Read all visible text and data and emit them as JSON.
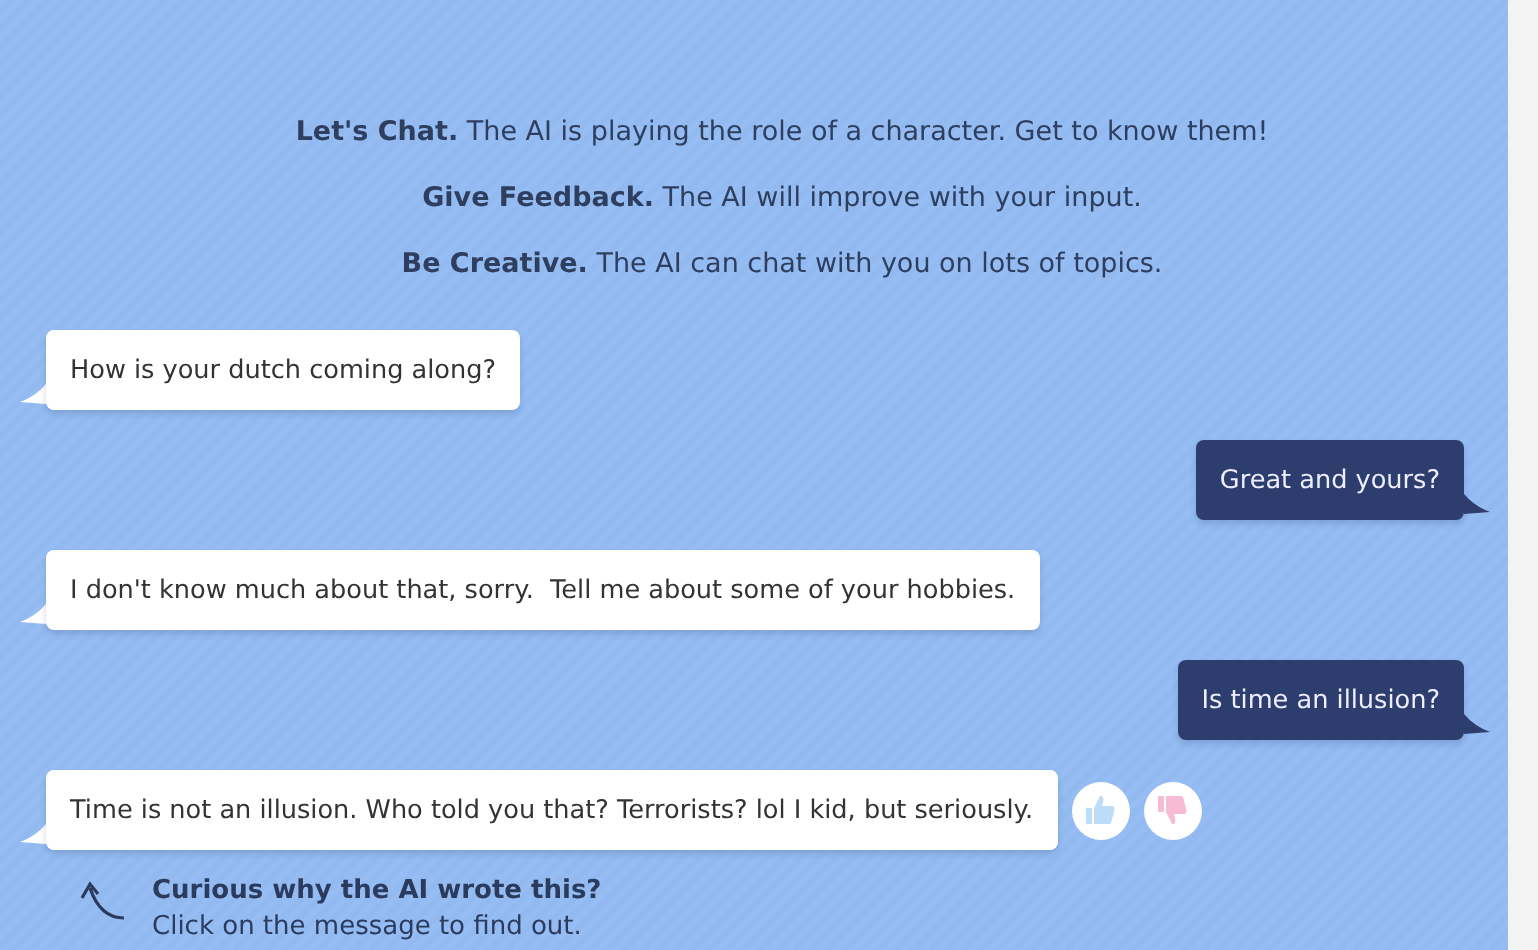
{
  "intro": [
    {
      "text": "**Let's Chat.** The AI is playing the role of a character. Get to know them!"
    },
    {
      "text": "**Give Feedback.** The AI will improve with your input."
    },
    {
      "text": "**Be Creative.** The AI can chat with you on lots of topics."
    }
  ],
  "messages": [
    {
      "kind": "bot",
      "text": "How is your dutch coming along?",
      "feedback": false
    },
    {
      "kind": "user",
      "text": "Great and yours?",
      "feedback": false
    },
    {
      "kind": "bot",
      "text": "I don't know much about that, sorry.  Tell me about some of your hobbies.",
      "feedback": false
    },
    {
      "kind": "user",
      "text": "Is time an illusion?",
      "feedback": false
    },
    {
      "kind": "bot",
      "text": "Time is not an illusion. Who told you that? Terrorists? lol I kid, but seriously.",
      "feedback": true
    }
  ],
  "hint": {
    "title": "Curious why the AI wrote this?",
    "text": "Click on the message to find out."
  }
}
